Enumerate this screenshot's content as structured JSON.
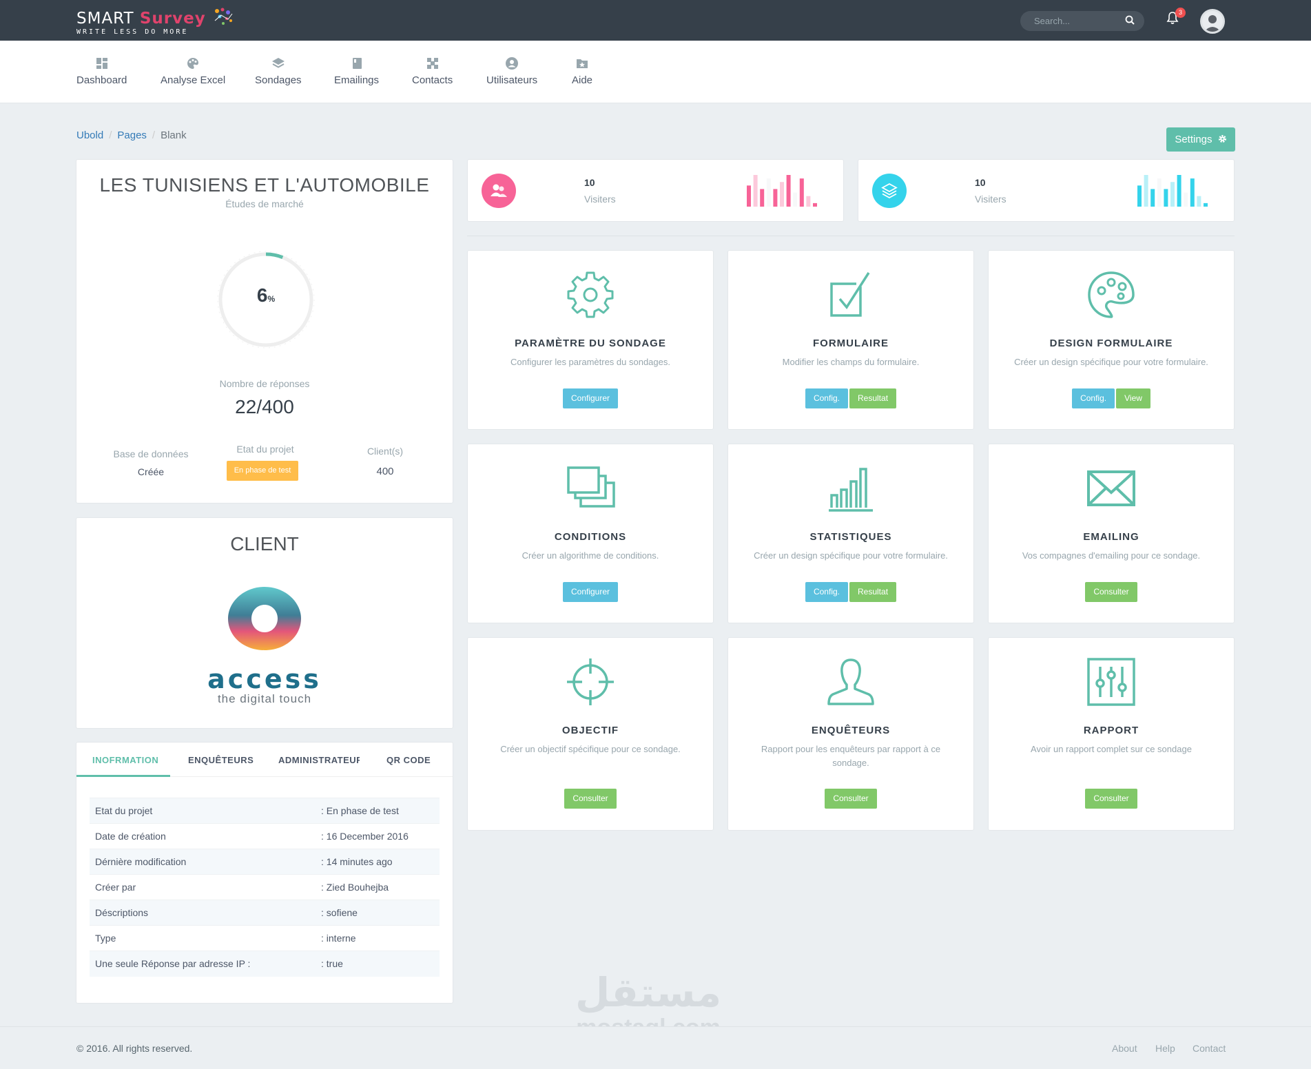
{
  "topbar": {
    "logo_smart": "SMART",
    "logo_survey": "Survey",
    "logo_tagline": "WRITE LESS DO MORE",
    "search_placeholder": "Search...",
    "notification_count": "3"
  },
  "nav": [
    {
      "label": "Dashboard",
      "icon": "dashboard-icon"
    },
    {
      "label": "Analyse Excel",
      "icon": "palette-icon"
    },
    {
      "label": "Sondages",
      "icon": "layers-icon"
    },
    {
      "label": "Emailings",
      "icon": "book-icon"
    },
    {
      "label": "Contacts",
      "icon": "contacts-icon"
    },
    {
      "label": "Utilisateurs",
      "icon": "user-circle-icon"
    },
    {
      "label": "Aide",
      "icon": "star-folder-icon"
    }
  ],
  "breadcrumb": [
    "Ubold",
    "Pages",
    "Blank"
  ],
  "settings_label": "Settings",
  "project": {
    "title": "LES TUNISIENS ET L'AUTOMOBILE",
    "subtitle": "Études de marché",
    "progress_value": "6",
    "progress_unit": "%",
    "progress_fraction": 0.06,
    "responses_label": "Nombre de réponses",
    "responses_value": "22/400",
    "db_label": "Base de données",
    "db_value": "Créée",
    "state_label": "Etat du projet",
    "state_value": "En phase de test",
    "clients_label": "Client(s)",
    "clients_value": "400"
  },
  "client": {
    "title": "CLIENT",
    "brand": "access",
    "brand_tagline": "the digital touch"
  },
  "tabs": [
    "INOFRMATION",
    "ENQUÊTEURS",
    "ADMINISTRATEURS",
    "QR CODE"
  ],
  "info_rows": [
    {
      "label": "Etat du projet",
      "value": ": En phase de test"
    },
    {
      "label": "Date de création",
      "value": ": 16 December 2016"
    },
    {
      "label": "Dérnière modification",
      "value": ": 14 minutes ago"
    },
    {
      "label": "Créer par",
      "value": ": Zied Bouhejba"
    },
    {
      "label": "Déscriptions",
      "value": ": sofiene"
    },
    {
      "label": "Type",
      "value": ": interne"
    },
    {
      "label": "Une seule Réponse par adresse IP :",
      "value": ": true"
    }
  ],
  "stats": [
    {
      "value": "10",
      "label": "Visiters",
      "color": "#f76397",
      "spark": [
        6,
        9,
        5,
        8,
        5,
        7,
        9,
        4,
        8,
        3,
        1
      ]
    },
    {
      "value": "10",
      "label": "Visiters",
      "color": "#34d3eb",
      "spark": [
        6,
        9,
        5,
        8,
        5,
        7,
        9,
        4,
        8,
        3,
        1
      ]
    }
  ],
  "tiles": [
    {
      "title": "PARAMÈTRE DU SONDAGE",
      "desc": "Configurer les paramètres du sondages.",
      "buttons": [
        {
          "label": "Configurer",
          "style": "info"
        }
      ],
      "icon": "gear-icon"
    },
    {
      "title": "FORMULAIRE",
      "desc": "Modifier les champs du formulaire.",
      "buttons": [
        {
          "label": "Config.",
          "style": "info"
        },
        {
          "label": "Resultat",
          "style": "success"
        }
      ],
      "icon": "checkbox-icon"
    },
    {
      "title": "DESIGN FORMULAIRE",
      "desc": "Créer un design spécifique pour votre formulaire.",
      "buttons": [
        {
          "label": "Config.",
          "style": "info"
        },
        {
          "label": "View",
          "style": "success"
        }
      ],
      "icon": "palette-icon"
    },
    {
      "title": "CONDITIONS",
      "desc": "Créer un algorithme de conditions.",
      "buttons": [
        {
          "label": "Configurer",
          "style": "info"
        }
      ],
      "icon": "copy-icon"
    },
    {
      "title": "STATISTIQUES",
      "desc": "Créer un design spécifique pour votre formulaire.",
      "buttons": [
        {
          "label": "Config.",
          "style": "info"
        },
        {
          "label": "Resultat",
          "style": "success"
        }
      ],
      "icon": "bar-chart-icon"
    },
    {
      "title": "EMAILING",
      "desc": "Vos compagnes d'emailing pour ce sondage.",
      "buttons": [
        {
          "label": "Consulter",
          "style": "success"
        }
      ],
      "icon": "envelope-icon"
    },
    {
      "title": "OBJECTIF",
      "desc": "Créer un objectif spécifique pour ce sondage.",
      "buttons": [
        {
          "label": "Consulter",
          "style": "success"
        }
      ],
      "icon": "crosshair-icon"
    },
    {
      "title": "ENQUÊTEURS",
      "desc": "Rapport pour les enquêteurs par rapport à ce sondage.",
      "buttons": [
        {
          "label": "Consulter",
          "style": "success"
        }
      ],
      "icon": "user-icon"
    },
    {
      "title": "RAPPORT",
      "desc": "Avoir un rapport complet sur ce sondage",
      "buttons": [
        {
          "label": "Consulter",
          "style": "success"
        }
      ],
      "icon": "sliders-icon"
    }
  ],
  "footer": {
    "copyright": "© 2016. All rights reserved.",
    "links": [
      "About",
      "Help",
      "Contact"
    ]
  },
  "watermark": {
    "arabic": "مستقل",
    "latin": "mostaql.com"
  },
  "colors": {
    "accent": "#5fbeaa",
    "topbar": "#36404a",
    "info": "#5bc0de",
    "success": "#81c868",
    "warning": "#ffbd4a",
    "pink": "#f76397",
    "cyan": "#34d3eb"
  }
}
